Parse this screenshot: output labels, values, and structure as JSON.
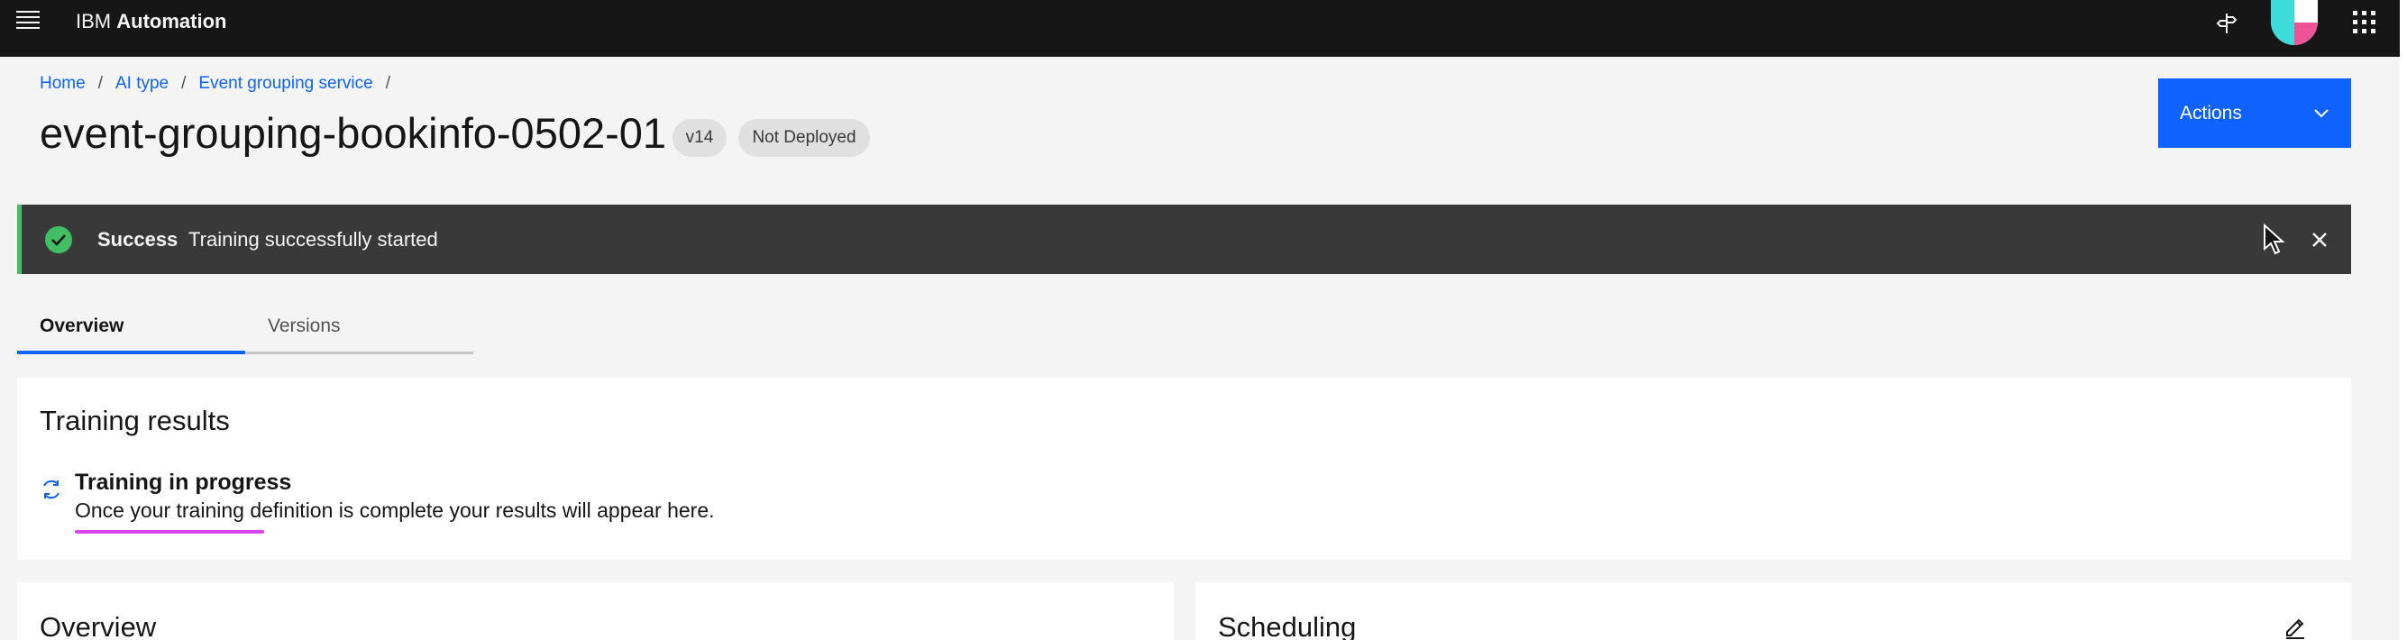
{
  "header": {
    "product_prefix": "IBM",
    "product_name": "Automation"
  },
  "breadcrumb": {
    "items": [
      "Home",
      "AI type",
      "Event grouping service"
    ],
    "separator": "/"
  },
  "page": {
    "title": "event-grouping-bookinfo-0502-01",
    "version_tag": "v14",
    "status_tag": "Not Deployed"
  },
  "actions": {
    "label": "Actions"
  },
  "notification": {
    "title": "Success",
    "message": "Training successfully started",
    "kind_color": "#42be65"
  },
  "tabs": [
    {
      "label": "Overview",
      "active": true
    },
    {
      "label": "Versions",
      "active": false
    }
  ],
  "training_results": {
    "title": "Training results",
    "status_heading": "Training in progress",
    "status_body": "Once your training definition is complete your results will appear here."
  },
  "overview_card": {
    "title": "Overview"
  },
  "scheduling_card": {
    "title": "Scheduling"
  },
  "icons": {
    "menu": "hamburger-menu-icon",
    "pin": "pin-icon",
    "apps": "app-switcher-icon",
    "success": "checkmark-filled-icon",
    "close": "close-icon",
    "chevron": "chevron-down-icon",
    "progress": "renew-icon",
    "edit": "edit-icon"
  },
  "colors": {
    "header_bg": "#161616",
    "primary": "#0f62fe",
    "notification_bg": "#393939",
    "success": "#42be65",
    "annotation_underline": "#d946ef"
  }
}
